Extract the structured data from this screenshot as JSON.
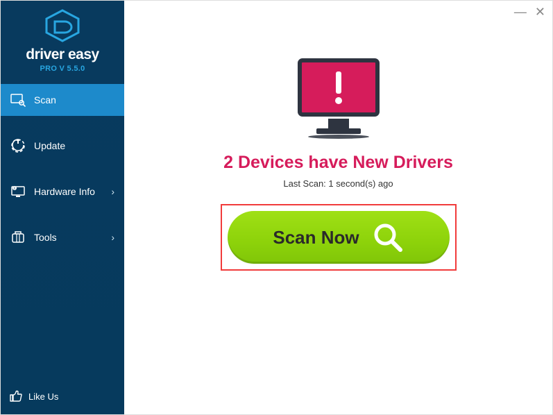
{
  "brand": {
    "name": "driver easy",
    "version": "PRO V 5.5.0"
  },
  "sidebar": {
    "items": [
      {
        "label": "Scan",
        "active": true,
        "hasChevron": false
      },
      {
        "label": "Update",
        "active": false,
        "hasChevron": false
      },
      {
        "label": "Hardware Info",
        "active": false,
        "hasChevron": true
      },
      {
        "label": "Tools",
        "active": false,
        "hasChevron": true
      }
    ],
    "likeUs": "Like Us"
  },
  "main": {
    "headline": "2 Devices have New Drivers",
    "lastScan": "Last Scan: 1 second(s) ago",
    "scanButton": "Scan Now"
  }
}
